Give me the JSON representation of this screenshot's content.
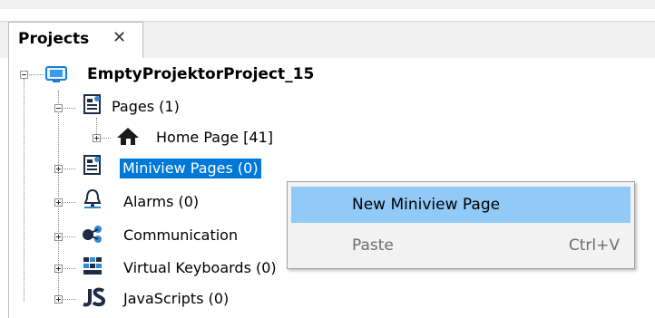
{
  "panel": {
    "tab_label": "Projects",
    "tab_close_glyph": "✕"
  },
  "tree": {
    "root": {
      "label": "EmptyProjektorProject_15",
      "icon": "project-icon"
    },
    "items": [
      {
        "label": "Pages (1)",
        "icon": "pages-icon",
        "expanded": true
      },
      {
        "label": "Home Page [41]",
        "icon": "home-icon",
        "expanded": false
      },
      {
        "label": "Miniview Pages (0)",
        "icon": "pages-icon",
        "expanded": false,
        "selected": true
      },
      {
        "label": "Alarms (0)",
        "icon": "alarm-bell-icon",
        "expanded": false
      },
      {
        "label": "Communication",
        "icon": "communication-icon",
        "expanded": false
      },
      {
        "label": "Virtual Keyboards (0)",
        "icon": "keyboard-icon",
        "expanded": false
      },
      {
        "label": "JavaScripts (0)",
        "icon": "javascript-icon",
        "expanded": false
      }
    ]
  },
  "context_menu": {
    "items": [
      {
        "label": "New Miniview Page",
        "shortcut": "",
        "highlighted": true,
        "enabled": true
      },
      {
        "label": "Paste",
        "shortcut": "Ctrl+V",
        "highlighted": false,
        "enabled": false
      }
    ]
  },
  "colors": {
    "selection": "#0078d7",
    "menu_highlight": "#91c9f7",
    "tab_strip": "#f0f0f0"
  }
}
